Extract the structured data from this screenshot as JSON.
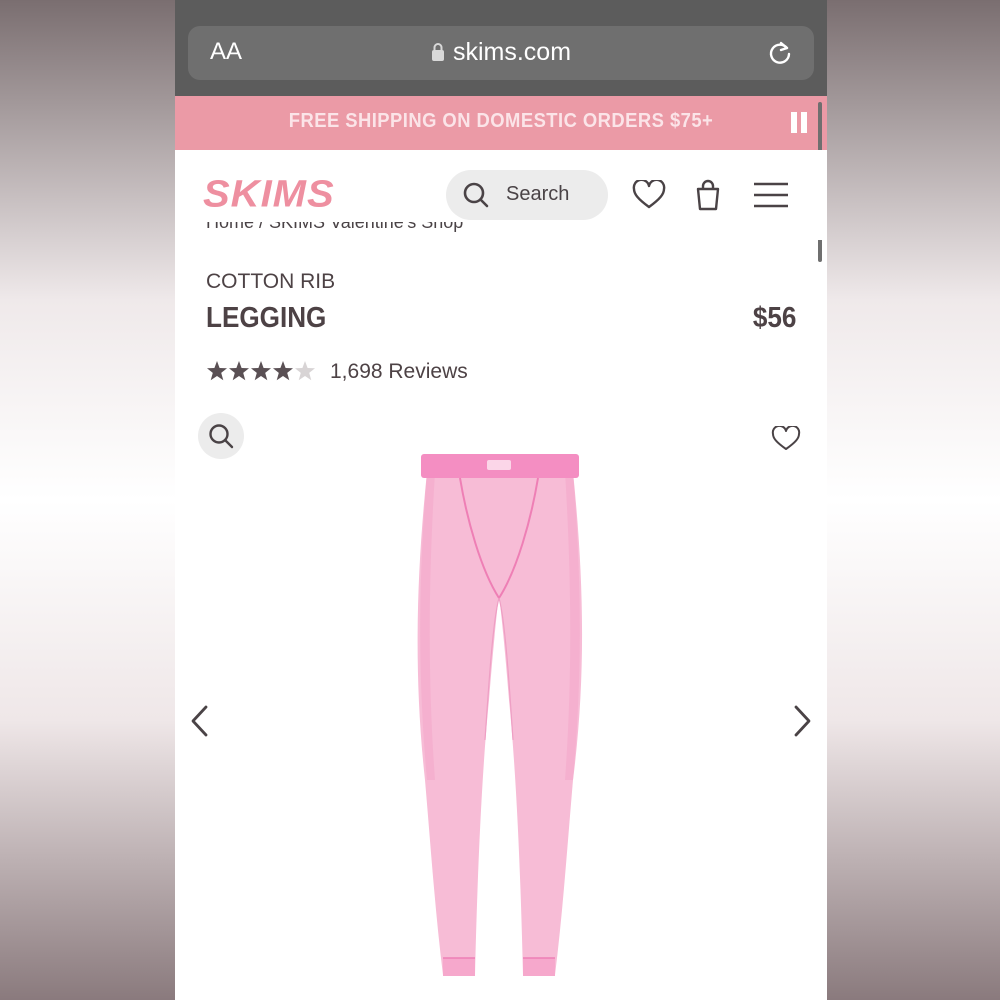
{
  "browser": {
    "aa_label": "AA",
    "url": "skims.com"
  },
  "promo": {
    "text": "FREE SHIPPING ON DOMESTIC ORDERS $75+"
  },
  "header": {
    "logo": "SKIMS",
    "search_label": "Search"
  },
  "breadcrumb": "Home / SKIMS Valentine's Shop",
  "product": {
    "collection": "COTTON RIB",
    "name": "LEGGING",
    "price": "$56",
    "rating": 4.6,
    "reviews": "1,698 Reviews",
    "color": "#f7b4d0"
  },
  "colors": {
    "brand_pink": "#ee8fa0",
    "promo_bg": "#eb9aa6",
    "text_dark": "#4d4245",
    "star": "#5a5054"
  },
  "icons": [
    "lock-icon",
    "reload-icon",
    "pause-icon",
    "search-icon",
    "heart-icon",
    "bag-icon",
    "menu-icon",
    "zoom-icon",
    "wishlist-heart-icon",
    "chevron-left-icon",
    "chevron-right-icon"
  ]
}
